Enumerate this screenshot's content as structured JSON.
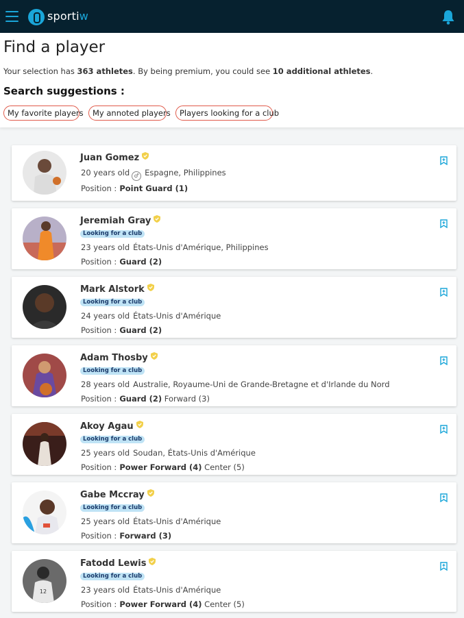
{
  "app": {
    "logo_text_main": "sporti",
    "logo_text_accent": "w"
  },
  "header": {
    "title": "Find a player",
    "selection_prefix": "Your selection has ",
    "athlete_count": "363 athletes",
    "selection_middle": ". By being premium, you could see ",
    "additional_count": "10 additional athletes",
    "selection_suffix": ".",
    "suggestions_title": "Search suggestions :",
    "chips": [
      "My favorite players",
      "My annoted players",
      "Players looking for a club"
    ]
  },
  "players": [
    {
      "name": "Juan Gomez",
      "badge": "",
      "age": "20 years old",
      "countries": "Espagne, Philippines",
      "position_label": "Position :",
      "main_position": "Point Guard (1)",
      "secondary_position": ""
    },
    {
      "name": "Jeremiah Gray",
      "badge": "Looking for a club",
      "age": "23 years old",
      "countries": "États-Unis d'Amérique, Philippines",
      "position_label": "Position :",
      "main_position": "Guard (2)",
      "secondary_position": ""
    },
    {
      "name": "Mark Alstork",
      "badge": "Looking for a club",
      "age": "24 years old",
      "countries": "États-Unis d'Amérique",
      "position_label": "Position :",
      "main_position": "Guard (2)",
      "secondary_position": ""
    },
    {
      "name": "Adam Thosby",
      "badge": "Looking for a club",
      "age": "28 years old",
      "countries": "Australie, Royaume-Uni de Grande-Bretagne et d'Irlande du Nord",
      "position_label": "Position :",
      "main_position": "Guard (2)",
      "secondary_position": "Forward (3)"
    },
    {
      "name": "Akoy Agau",
      "badge": "Looking for a club",
      "age": "25 years old",
      "countries": "Soudan, États-Unis d'Amérique",
      "position_label": "Position :",
      "main_position": "Power Forward (4)",
      "secondary_position": "Center (5)"
    },
    {
      "name": "Gabe Mccray",
      "badge": "Looking for a club",
      "age": "25 years old",
      "countries": "États-Unis d'Amérique",
      "position_label": "Position :",
      "main_position": "Forward (3)",
      "secondary_position": ""
    },
    {
      "name": "Fatodd Lewis",
      "badge": "Looking for a club",
      "age": "23 years old",
      "countries": "États-Unis d'Amérique",
      "position_label": "Position :",
      "main_position": "Power Forward (4)",
      "secondary_position": "Center (5)"
    }
  ],
  "icons": {
    "menu": "hamburger-icon",
    "notifications": "bell-icon",
    "verified": "shield-check-icon",
    "bookmark": "bookmark-add-icon",
    "gender": "male-icon"
  },
  "colors": {
    "topbar": "#06212f",
    "accent": "#1aa6d9",
    "chip_border": "#e05a4a",
    "badge_bg": "#bfe3f5",
    "verified": "#f2d04a"
  }
}
